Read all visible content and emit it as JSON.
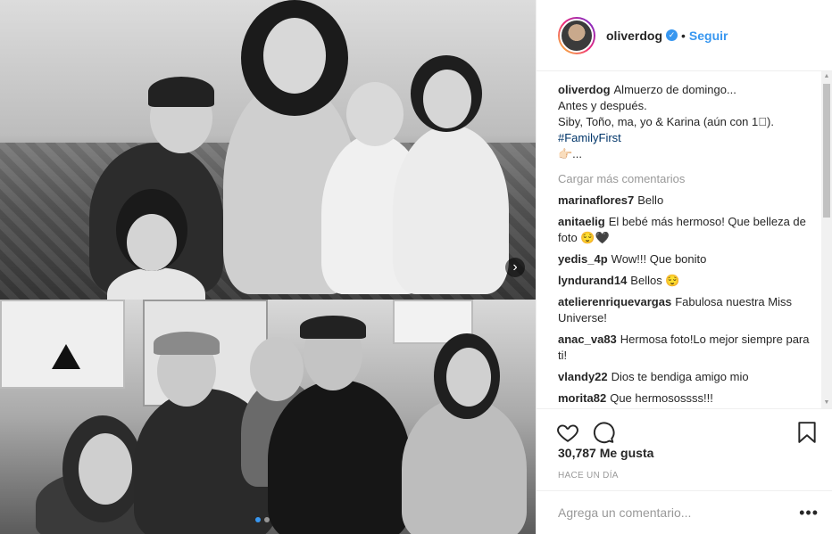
{
  "post": {
    "username": "oliverdog",
    "separator": "•",
    "follow_label": "Seguir",
    "verified_icon": "verified-badge-icon"
  },
  "caption": {
    "username": "oliverdog",
    "lines": [
      "Almuerzo de domingo...",
      "Antes y después.",
      "Siby, Toño, ma, yo & Karina (aún con 1⃣).",
      "#FamilyFirst",
      "👉🏻..."
    ]
  },
  "load_more_label": "Cargar más comentarios",
  "comments": [
    {
      "user": "marinaflores7",
      "text": "Bello"
    },
    {
      "user": "anitaelig",
      "text": "El bebé más hermoso! Que belleza de foto 😌🖤"
    },
    {
      "user": "yedis_4p",
      "text": "Wow!!! Que bonito"
    },
    {
      "user": "lyndurand14",
      "text": "Bellos 😌"
    },
    {
      "user": "atelierenriquevargas",
      "text": "Fabulosa nuestra Miss Universe!"
    },
    {
      "user": "anac_va83",
      "text": "Hermosa foto!Lo mejor siempre para ti!"
    },
    {
      "user": "vlandy22",
      "text": "Dios te bendiga amigo mio"
    },
    {
      "user": "morita82",
      "text": "Que hermosossss!!!"
    }
  ],
  "likes_label": "30,787 Me gusta",
  "time_label": "HACE UN DÍA",
  "add_comment_placeholder": "Agrega un comentario...",
  "more_options_label": "•••",
  "carousel": {
    "next_glyph": "›",
    "dot_count": 2,
    "active_index": 0
  },
  "colors": {
    "accent": "#3897f0",
    "text": "#262626",
    "muted": "#999999",
    "hashtag": "#003569"
  }
}
